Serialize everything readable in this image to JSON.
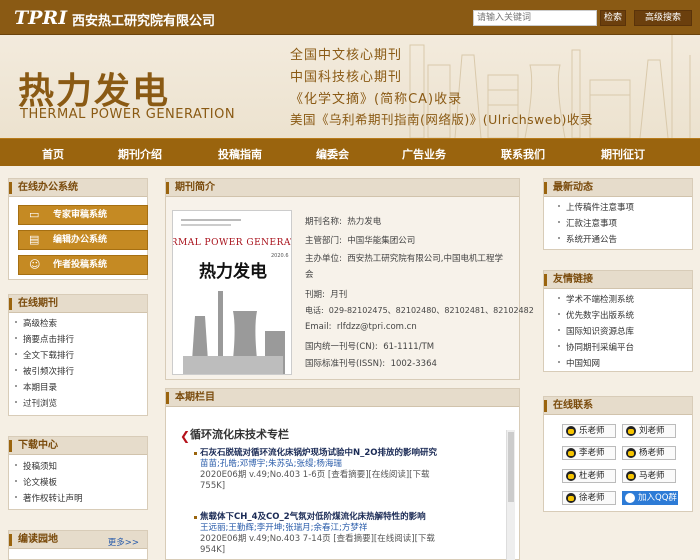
{
  "header": {
    "logo_text": "TPRI",
    "institute": "西安热工研究院有限公司",
    "search_placeholder": "请输入关键词",
    "search_button": "检索",
    "advanced_button": "高级搜索"
  },
  "banner": {
    "title": "热力发电",
    "title_en": "THERMAL POWER GENERATION",
    "slogans": [
      "全国中文核心期刊",
      "中国科技核心期刊",
      "《化学文摘》(简称CA)收录",
      "美国《乌利希期刊指南(网络版)》(Ulrichsweb)收录"
    ]
  },
  "nav": {
    "items": [
      "首页",
      "期刊介绍",
      "投稿指南",
      "编委会",
      "广告业务",
      "联系我们",
      "期刊征订"
    ]
  },
  "left": {
    "office": {
      "title": "在线办公系统",
      "buttons": [
        "专家审稿系统",
        "编辑办公系统",
        "作者投稿系统"
      ]
    },
    "journal": {
      "title": "在线期刊",
      "items": [
        "高级检索",
        "摘要点击排行",
        "全文下载排行",
        "被引频次排行",
        "本期目录",
        "过刊浏览"
      ]
    },
    "download": {
      "title": "下载中心",
      "items": [
        "投稿须知",
        "论文模板",
        "著作权转让声明"
      ]
    },
    "garden": {
      "title": "编读园地",
      "more": "更多>>"
    }
  },
  "center": {
    "intro_title": "期刊简介",
    "cover": {
      "en": "THERMAL POWER GENERATION",
      "cn": "热力发电",
      "issue": "2020.6"
    },
    "info": [
      {
        "label": "期刊名称:",
        "value": "热力发电"
      },
      {
        "label": "主管部门:",
        "value": "中国华能集团公司"
      },
      {
        "label": "主办单位:",
        "value": "西安热工研究院有限公司,中国电机工程学"
      },
      {
        "label": "",
        "value": "会"
      },
      {
        "label": "刊期:",
        "value": "月刊"
      },
      {
        "label": "电话:",
        "value": "029-82102475、82102480、82102481、82102482"
      },
      {
        "label": "Email:",
        "value": "rlfdzz@tpri.com.cn"
      },
      {
        "label": "国内统一刊号(CN):",
        "value": "61-1111/TM"
      },
      {
        "label": "国际标准刊号(ISSN):",
        "value": "1002-3364"
      }
    ],
    "current_title": "本期栏目",
    "section": "循环流化床技术专栏",
    "articles": [
      {
        "title": "石灰石脱硫对循环流化床锅炉现场试验中N_2O排放的影响研究",
        "authors": "苗苗;孔皓;邓博宇;朱苏弘;张缦;杨海瑞",
        "meta": "2020E06期 v.49;No.403 1-6页 [查看摘要][在线阅读][下载",
        "size": "755K]"
      },
      {
        "title": "焦载体下CH_4及CO_2气氛对低阶煤流化床热解特性的影响",
        "authors": "王远丽;王勤辉;李开坤;张瑞月;余春江;方梦祥",
        "meta": "2020E06期 v.49;No.403 7-14页 [查看摘要][在线阅读][下载",
        "size": "954K]"
      }
    ]
  },
  "right": {
    "news": {
      "title": "最新动态",
      "items": [
        "上传稿件注意事项",
        "汇款注意事项",
        "系统开通公告"
      ]
    },
    "links": {
      "title": "友情链接",
      "items": [
        "学术不端检测系统",
        "优先数字出版系统",
        "国际知识资源总库",
        "协同期刊采编平台",
        "中国知网"
      ]
    },
    "contact": {
      "title": "在线联系",
      "buttons": [
        "乐老师",
        "刘老师",
        "李老师",
        "杨老师",
        "杜老师",
        "马老师",
        "徐老师"
      ],
      "group": "加入QQ群"
    }
  }
}
